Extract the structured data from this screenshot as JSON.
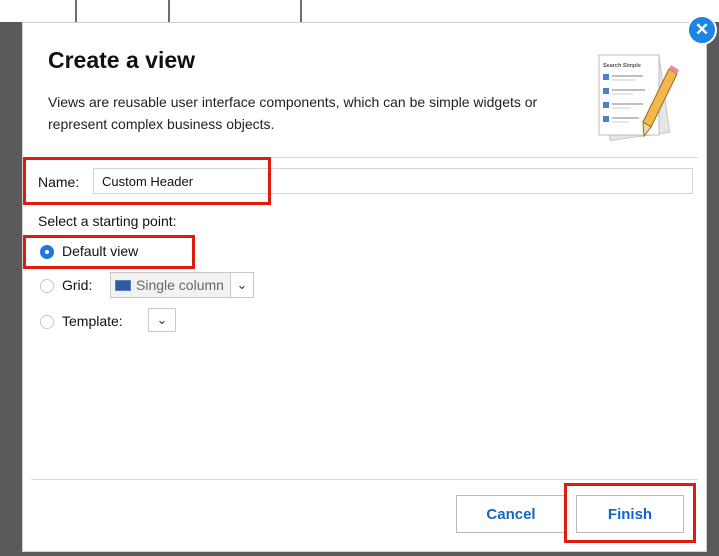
{
  "dialog": {
    "title": "Create a view",
    "description": "Views are reusable user interface components, which can be simple widgets or represent complex business objects.",
    "header_image_title": "Search Simple"
  },
  "name_field": {
    "label": "Name:",
    "value": "Custom Header"
  },
  "starting_point": {
    "label": "Select a starting point:",
    "options": [
      {
        "label": "Default view",
        "selected": true
      },
      {
        "label": "Grid:",
        "selected": false
      },
      {
        "label": "Template:",
        "selected": false
      }
    ],
    "grid_select_value": "Single column"
  },
  "buttons": {
    "cancel": "Cancel",
    "finish": "Finish"
  },
  "colors": {
    "accent": "#1f78e0",
    "button_text": "#1565c8",
    "highlight": "#e11b0c"
  },
  "icons": {
    "close": "close-icon",
    "grid_column": "single-column-icon",
    "caret": "chevron-down-icon",
    "header": "checklist-pencil-icon"
  }
}
